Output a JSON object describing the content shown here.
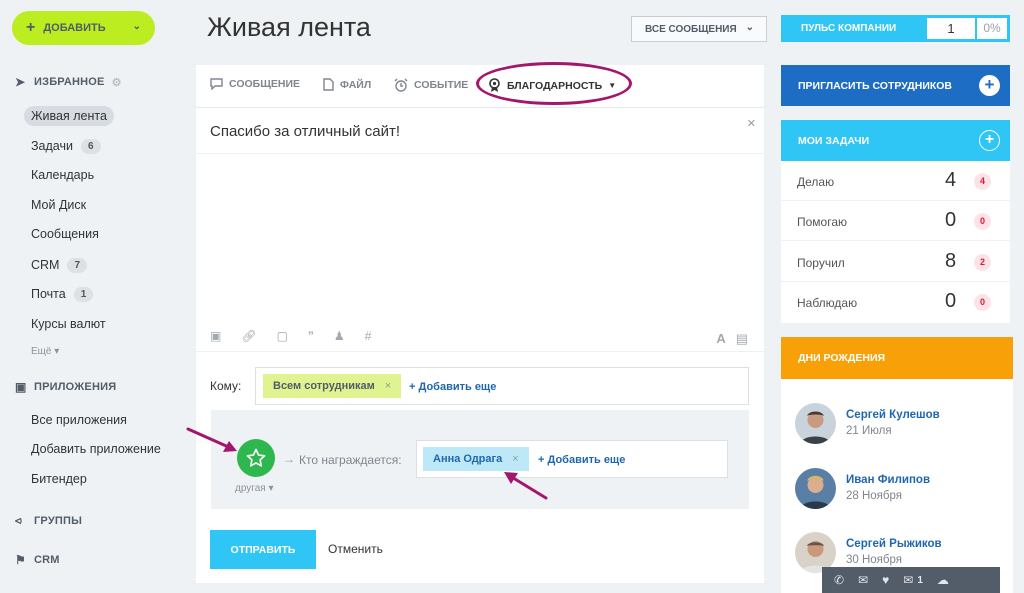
{
  "sidebar": {
    "add_button": "ДОБАВИТЬ",
    "favorites_title": "ИЗБРАННОЕ",
    "items": [
      {
        "label": "Живая лента"
      },
      {
        "label": "Задачи",
        "count": "6"
      },
      {
        "label": "Календарь"
      },
      {
        "label": "Мой Диск"
      },
      {
        "label": "Сообщения"
      },
      {
        "label": "CRM",
        "count": "7"
      },
      {
        "label": "Почта",
        "count": "1"
      },
      {
        "label": "Курсы валют"
      }
    ],
    "more": "Ещё ▾",
    "apps_title": "ПРИЛОЖЕНИЯ",
    "apps": [
      {
        "label": "Все приложения"
      },
      {
        "label": "Добавить приложение"
      },
      {
        "label": "Битендер"
      }
    ],
    "groups_title": "ГРУППЫ",
    "crm_title": "CRM"
  },
  "header": {
    "title": "Живая лента",
    "filter": "ВСЕ СООБЩЕНИЯ",
    "pulse_label": "ПУЛЬС КОМПАНИИ",
    "pulse_value": "1",
    "pulse_percent": "0%"
  },
  "composer": {
    "tabs": {
      "message": "СООБЩЕНИЕ",
      "file": "ФАЙЛ",
      "event": "СОБЫТИЕ",
      "gratitude": "БЛАГОДАРНОСТЬ"
    },
    "text": "Спасибо за отличный сайт!",
    "to_label": "Кому:",
    "to_chip": "Всем сотрудникам",
    "add_more": "Добавить еще",
    "grat_type": "другая ▾",
    "who_label": "Кто награждается:",
    "who_chip": "Анна Одрага",
    "send": "ОТПРАВИТЬ",
    "cancel": "Отменить"
  },
  "right": {
    "invite": "ПРИГЛАСИТЬ СОТРУДНИКОВ",
    "tasks_title": "МОИ ЗАДАЧИ",
    "tasks": [
      {
        "label": "Делаю",
        "value": "4",
        "badge": "4"
      },
      {
        "label": "Помогаю",
        "value": "0",
        "badge": "0"
      },
      {
        "label": "Поручил",
        "value": "8",
        "badge": "2"
      },
      {
        "label": "Наблюдаю",
        "value": "0",
        "badge": "0"
      }
    ],
    "birthdays_title": "ДНИ РОЖДЕНИЯ",
    "birthdays": [
      {
        "name": "Сергей Кулешов",
        "date": "21 Июля"
      },
      {
        "name": "Иван Филипов",
        "date": "28 Ноября"
      },
      {
        "name": "Сергей Рыжиков",
        "date": "30 Ноября"
      }
    ]
  },
  "im_bar": {
    "messages_count": "1"
  },
  "colors": {
    "accent_green": "#bbed21",
    "accent_blue": "#2fc6f6",
    "dark_blue": "#1d6dc4",
    "orange": "#f8a008",
    "annotation": "#a3166d"
  }
}
